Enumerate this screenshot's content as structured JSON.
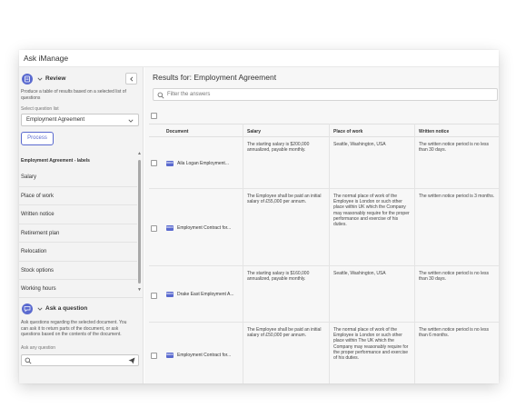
{
  "app": {
    "title": "Ask iManage"
  },
  "review": {
    "title": "Review",
    "description": "Produce a table of results based on a selected list of questions",
    "select_label": "Select question list",
    "selected_list": "Employment Agreement",
    "process_label": "Process",
    "list_header": "Employment Agreement - labels",
    "items": [
      {
        "label": "Salary"
      },
      {
        "label": "Place of work"
      },
      {
        "label": "Written notice"
      },
      {
        "label": "Retirement plan"
      },
      {
        "label": "Relocation"
      },
      {
        "label": "Stock options"
      },
      {
        "label": "Working hours"
      }
    ]
  },
  "ask": {
    "title": "Ask a question",
    "description": "Ask questions regarding the selected document. You can ask it to return parts of the document, or ask questions based on the contents of the document.",
    "input_label": "Ask any question",
    "input_placeholder": ""
  },
  "results": {
    "title": "Results for: Employment Agreement",
    "filter_placeholder": "Filter the answers",
    "columns": [
      "Document",
      "Salary",
      "Place of work",
      "Written notice"
    ],
    "rows": [
      {
        "doc_badge": "DOCX",
        "document": "Aila Logan Employment...",
        "salary": "The starting salary is $200,000 annualized, payable monthly.",
        "place": "Seattle, Washington, USA",
        "notice": "The written notice period is no less than 30 days."
      },
      {
        "doc_badge": "DOCX",
        "document": "Employment Contract for...",
        "salary": "The Employee shall be paid an initial salary of £55,000 per annum.",
        "place": "The normal place of work of the Employee is London or such other place within UK which the Company may reasonably require for the proper performance and exercise of his duties.",
        "notice": "The written notice period is 3 months."
      },
      {
        "doc_badge": "DOCX",
        "document": "Drake East Employment A...",
        "salary": "The starting salary is $160,000 annualized, payable monthly.",
        "place": "Seattle, Washington, USA",
        "notice": "The written notice period is no less than 30 days."
      },
      {
        "doc_badge": "DOCX",
        "document": "Employment Contract for...",
        "salary": "The Employee shall be paid an initial salary of £50,000 per annum.",
        "place": "The normal place of work of the Employee is London or such other place within The UK which the Company may reasonably require for the proper performance and exercise of his duties.",
        "notice": "The written notice period is no less than 6 months."
      }
    ]
  },
  "colors": {
    "accent": "#5a6acf",
    "panel": "#f3f3f3",
    "divider": "#e4e4e4"
  }
}
